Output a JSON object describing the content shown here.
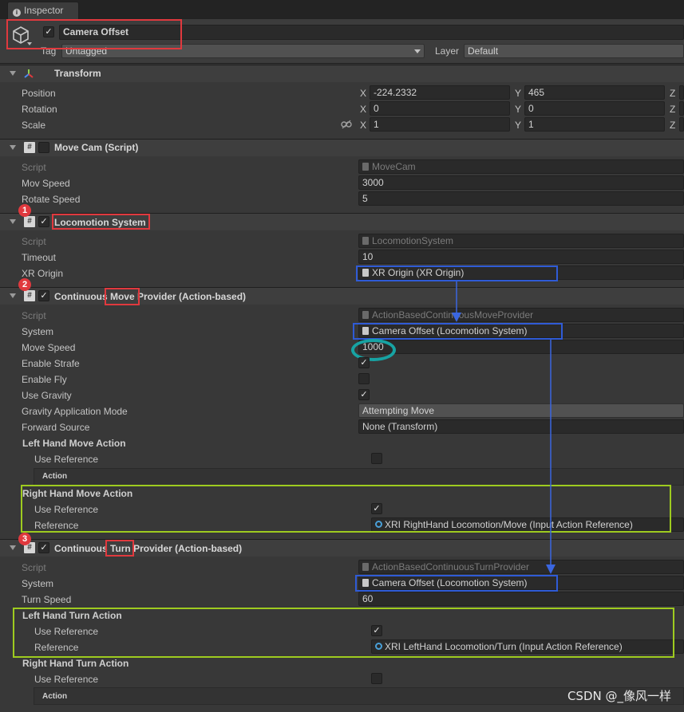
{
  "tab": {
    "label": "Inspector"
  },
  "object": {
    "name": "Camera Offset",
    "tag_label": "Tag",
    "tag_value": "Untagged",
    "layer_label": "Layer",
    "layer_value": "Default"
  },
  "transform": {
    "title": "Transform",
    "position_label": "Position",
    "rotation_label": "Rotation",
    "scale_label": "Scale",
    "axis_x": "X",
    "axis_y": "Y",
    "axis_z": "Z",
    "position": {
      "x": "-224.2332",
      "y": "465"
    },
    "rotation": {
      "x": "0",
      "y": "0"
    },
    "scale": {
      "x": "1",
      "y": "1"
    }
  },
  "move_cam": {
    "title": "Move Cam (Script)",
    "script_label": "Script",
    "script_value": "MoveCam",
    "mov_speed_label": "Mov Speed",
    "mov_speed_value": "3000",
    "rotate_speed_label": "Rotate Speed",
    "rotate_speed_value": "5"
  },
  "locomotion": {
    "badge": "1",
    "title": "Locomotion System",
    "script_label": "Script",
    "script_value": "LocomotionSystem",
    "timeout_label": "Timeout",
    "timeout_value": "10",
    "xr_origin_label": "XR Origin",
    "xr_origin_value": "XR Origin (XR Origin)"
  },
  "move_provider": {
    "badge": "2",
    "title_pre": "Continuous ",
    "title_mid": "Move",
    "title_post": " Provider (Action-based)",
    "script_label": "Script",
    "script_value": "ActionBasedContinuousMoveProvider",
    "system_label": "System",
    "system_value": "Camera Offset (Locomotion System)",
    "move_speed_label": "Move Speed",
    "move_speed_value": "1000",
    "enable_strafe_label": "Enable Strafe",
    "enable_fly_label": "Enable Fly",
    "use_gravity_label": "Use Gravity",
    "gravity_mode_label": "Gravity Application Mode",
    "gravity_mode_value": "Attempting Move",
    "forward_source_label": "Forward Source",
    "forward_source_value": "None (Transform)",
    "left_action_label": "Left Hand Move Action",
    "use_reference_label": "Use Reference",
    "action_label": "Action",
    "right_action_label": "Right Hand Move Action",
    "reference_label": "Reference",
    "right_reference_value": "XRI RightHand Locomotion/Move (Input Action Reference)"
  },
  "turn_provider": {
    "badge": "3",
    "title_pre": "Continuous ",
    "title_mid": "Turn",
    "title_post": " Provider (Action-based)",
    "script_label": "Script",
    "script_value": "ActionBasedContinuousTurnProvider",
    "system_label": "System",
    "system_value": "Camera Offset (Locomotion System)",
    "turn_speed_label": "Turn Speed",
    "turn_speed_value": "60",
    "left_action_label": "Left Hand Turn Action",
    "use_reference_label": "Use Reference",
    "reference_label": "Reference",
    "left_reference_value": "XRI LeftHand Locomotion/Turn (Input Action Reference)",
    "right_action_label": "Right Hand Turn Action",
    "action_label": "Action"
  },
  "check_mark": "✓",
  "component_icon": "#",
  "watermark": "CSDN @_像风一样",
  "colors": {
    "annotation_red": "#e0393e",
    "annotation_blue": "#2f5bd6",
    "annotation_green": "#9ecb1f",
    "annotation_teal": "#17a3a3"
  }
}
